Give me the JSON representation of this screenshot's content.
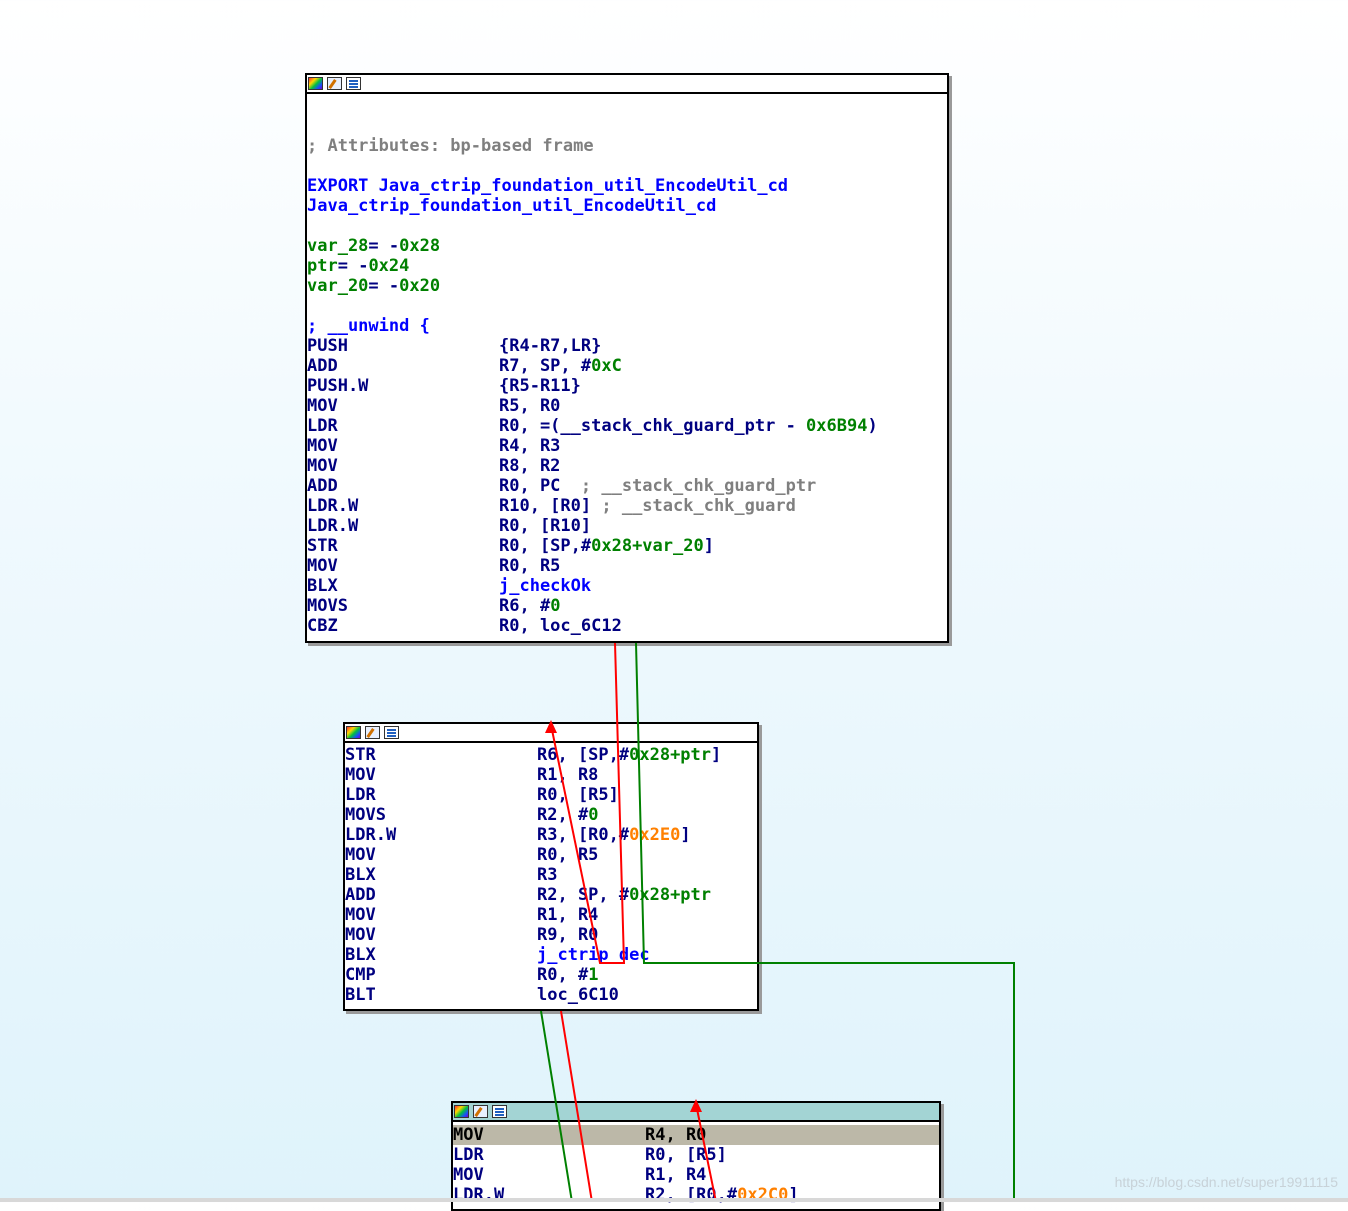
{
  "block1": {
    "comment": "; Attributes: bp-based frame",
    "export_line": "EXPORT Java_ctrip_foundation_util_EncodeUtil_cd",
    "func_name": "Java_ctrip_foundation_util_EncodeUtil_cd",
    "vars": [
      {
        "name": "var_28",
        "eq": "= -",
        "val": "0x28"
      },
      {
        "name": "ptr",
        "eq": "= -",
        "val": "0x24"
      },
      {
        "name": "var_20",
        "eq": "= -",
        "val": "0x20"
      }
    ],
    "unwind": "; __unwind {",
    "instructions": [
      {
        "mn": "PUSH",
        "op": "{R4-R7,LR}"
      },
      {
        "mn": "ADD",
        "op_a": "R7, SP, #",
        "op_b": "0xC"
      },
      {
        "mn": "PUSH.W",
        "op": "{R5-R11}"
      },
      {
        "mn": "MOV",
        "op": "R5, R0"
      },
      {
        "mn": "LDR",
        "op_a": "R0, =(__stack_chk_guard_ptr - ",
        "op_b": "0x6B94",
        "op_c": ")"
      },
      {
        "mn": "MOV",
        "op": "R4, R3"
      },
      {
        "mn": "MOV",
        "op": "R8, R2"
      },
      {
        "mn": "ADD",
        "op": "R0, PC",
        "cmt": "  ; __stack_chk_guard_ptr"
      },
      {
        "mn": "LDR.W",
        "op": "R10, [R0]",
        "cmt": " ; __stack_chk_guard"
      },
      {
        "mn": "LDR.W",
        "op": "R0, [R10]"
      },
      {
        "mn": "STR",
        "op_a": "R0, [SP,#",
        "op_b": "0x28+var_20",
        "op_c": "]"
      },
      {
        "mn": "MOV",
        "op": "R0, R5"
      },
      {
        "mn": "BLX",
        "lnk": "j_checkOk"
      },
      {
        "mn": "MOVS",
        "op_a": "R6, #",
        "op_b": "0"
      },
      {
        "mn": "CBZ",
        "op": "R0, loc_6C12"
      }
    ]
  },
  "block2": {
    "instructions": [
      {
        "mn": "STR",
        "op_a": "R6, [SP,#",
        "op_b": "0x28+ptr",
        "op_c": "]"
      },
      {
        "mn": "MOV",
        "op": "R1, R8"
      },
      {
        "mn": "LDR",
        "op": "R0, [R5]"
      },
      {
        "mn": "MOVS",
        "op_a": "R2, #",
        "op_b": "0"
      },
      {
        "mn": "LDR.W",
        "op_a": "R3, [R0,#",
        "op_o": "0x2E0",
        "op_c": "]"
      },
      {
        "mn": "MOV",
        "op": "R0, R5"
      },
      {
        "mn": "BLX",
        "op": "R3"
      },
      {
        "mn": "ADD",
        "op_a": "R2, SP, #",
        "op_b": "0x28+ptr"
      },
      {
        "mn": "MOV",
        "op": "R1, R4"
      },
      {
        "mn": "MOV",
        "op": "R9, R0"
      },
      {
        "mn": "BLX",
        "lnk": "j_ctrip_dec"
      },
      {
        "mn": "CMP",
        "op_a": "R0, #",
        "op_b": "1"
      },
      {
        "mn": "BLT",
        "op": "loc_6C10"
      }
    ]
  },
  "block3": {
    "instructions": [
      {
        "mn": "MOV",
        "op": "R4, R0"
      },
      {
        "mn": "LDR",
        "op": "R0, [R5]"
      },
      {
        "mn": "MOV",
        "op": "R1, R4"
      },
      {
        "mn": "LDR.W",
        "op_a": "R2, [R0,#",
        "op_o": "0x2C0",
        "op_c": "]"
      }
    ]
  },
  "colors": {
    "instruction": "#000080",
    "immediate": "#008000",
    "offset": "#ff8000",
    "comment": "#7f7f7f",
    "name": "#0000ff",
    "edge_true": "#008000",
    "edge_false": "#ff0000",
    "selected_line": "#bcb8a8",
    "header_active": "#a3d4d4"
  },
  "watermark": "https://blog.csdn.net/super19911115"
}
